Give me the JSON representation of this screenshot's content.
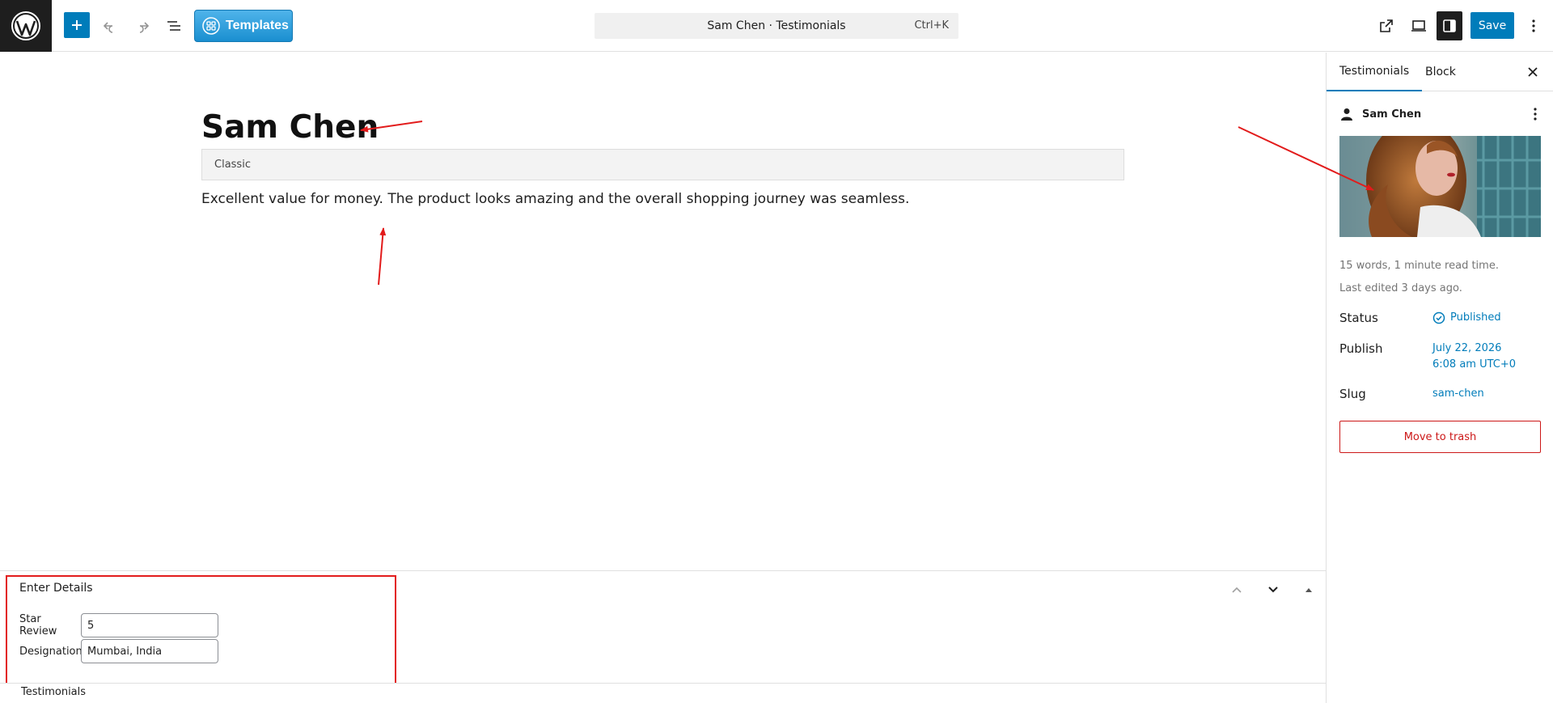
{
  "toolbar": {
    "add_block_label": "Add block",
    "templates_label": "Templates",
    "command_bar_title": "Sam Chen · Testimonials",
    "command_shortcut": "Ctrl+K",
    "save_label": "Save"
  },
  "post": {
    "title": "Sam Chen",
    "classic_block_label": "Classic",
    "body": "Excellent value for money. The product looks amazing and the overall shopping journey was seamless."
  },
  "metabox": {
    "title": "Enter Details",
    "fields": [
      {
        "label": "Star Review",
        "value": "5"
      },
      {
        "label": "Designation",
        "value": "Mumbai, India"
      }
    ]
  },
  "footer": {
    "breadcrumb": "Testimonials"
  },
  "sidebar": {
    "tabs": [
      {
        "label": "Testimonials",
        "active": true
      },
      {
        "label": "Block",
        "active": false
      }
    ],
    "post_name": "Sam Chen",
    "word_count": "15 words, 1 minute read time.",
    "last_edited": "Last edited 3 days ago.",
    "status_label": "Status",
    "status_value": "Published",
    "publish_label": "Publish",
    "publish_date": "July 22, 2026",
    "publish_time": "6:08 am UTC+0",
    "slug_label": "Slug",
    "slug_value": "sam-chen",
    "trash_label": "Move to trash"
  },
  "colors": {
    "accent": "#007cba",
    "danger": "#cc1818",
    "annotation": "#e21b1b",
    "dark": "#1e1e1e"
  },
  "icons": [
    "wordpress-logo",
    "plus-icon",
    "undo-icon",
    "redo-icon",
    "list-view-icon",
    "templates-grid-icon",
    "external-link-icon",
    "desktop-preview-icon",
    "sidebar-toggle-icon",
    "more-vertical-icon",
    "close-icon",
    "author-icon",
    "check-circle-icon",
    "chevron-up-icon",
    "chevron-down-icon",
    "triangle-up-icon"
  ]
}
